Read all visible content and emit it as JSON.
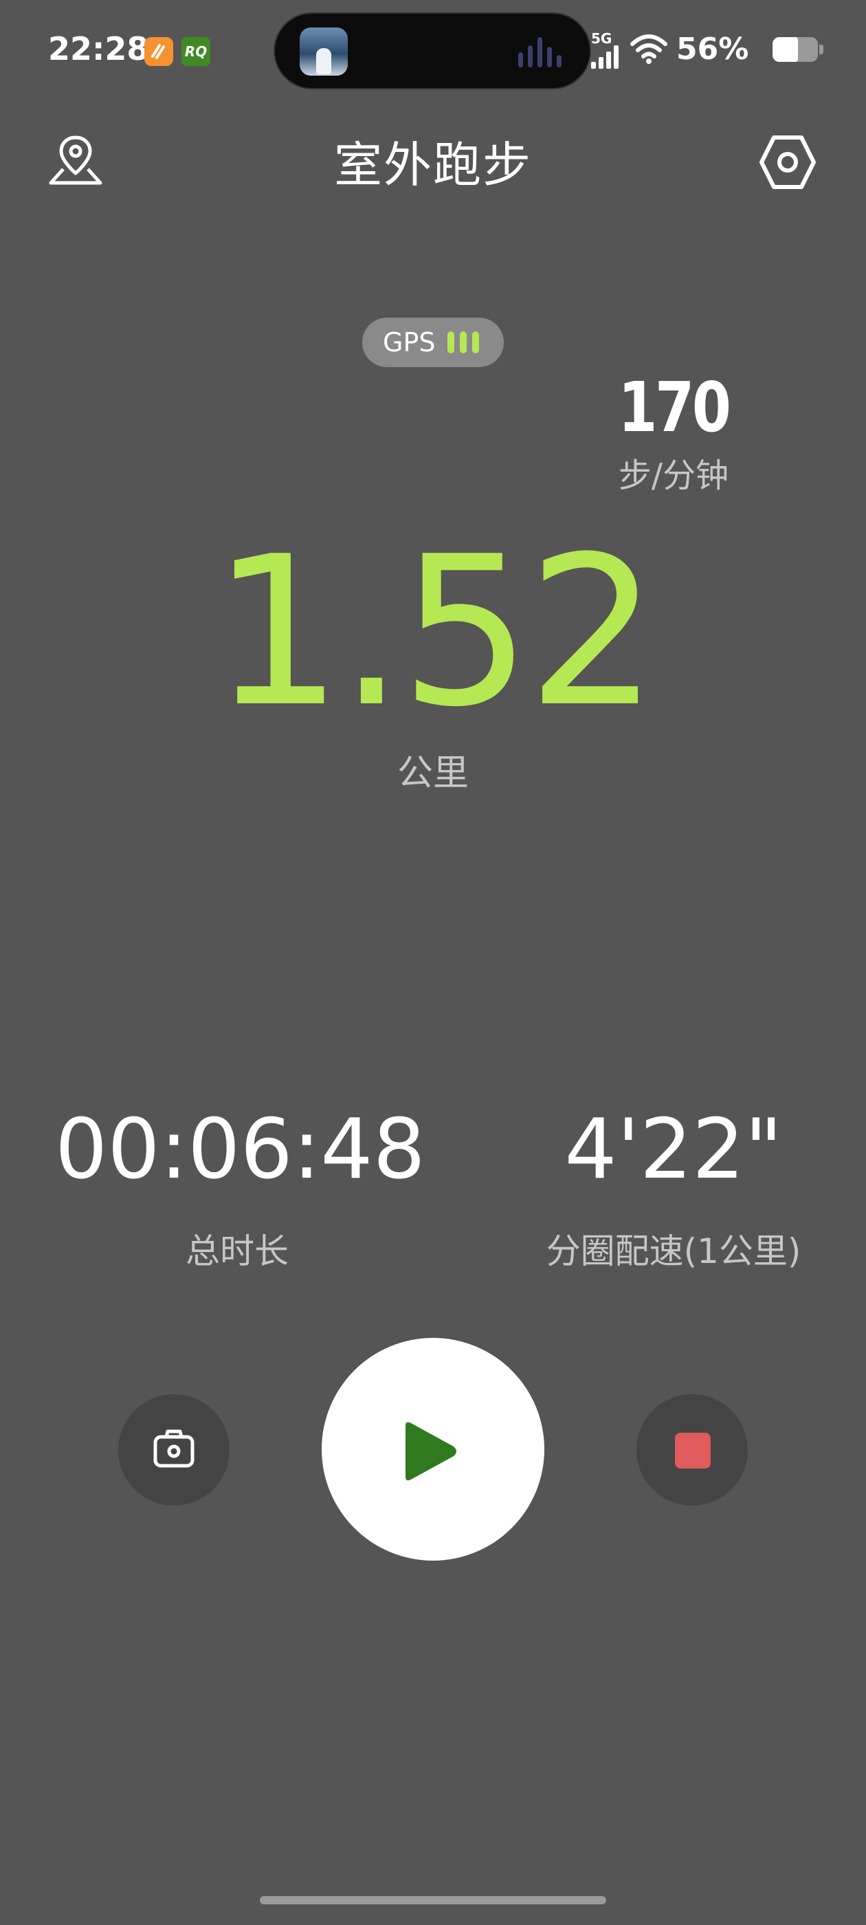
{
  "status_bar": {
    "time": "22:28",
    "app_badge_2_text": "RQ",
    "network": "5G",
    "battery_percent_text": "56%",
    "battery_level": 0.56,
    "icons": [
      "app-badge-orange-icon",
      "app-badge-rq-icon",
      "now-playing-art-icon",
      "audio-wave-icon",
      "signal-icon",
      "wifi-icon",
      "battery-icon"
    ]
  },
  "header": {
    "title": "室外跑步",
    "left_icon": "map-pin-icon",
    "right_icon": "settings-hexagon-icon"
  },
  "gps": {
    "label": "GPS",
    "signal_bars": 3
  },
  "cadence": {
    "value": "170",
    "unit": "步/分钟"
  },
  "distance": {
    "value": "1.52",
    "unit": "公里"
  },
  "metrics": {
    "duration_value": "00:06:48",
    "duration_label": "总时长",
    "pace_value": "4'22\"",
    "pace_label": "分圈配速(1公里)"
  },
  "controls": {
    "left_icon": "camera-icon",
    "center_icon": "play-icon",
    "right_icon": "stop-icon"
  },
  "colors": {
    "background": "#555555",
    "accent_green": "#b5e853",
    "play_green": "#2f7a1e",
    "stop_red": "#e05c5c"
  }
}
